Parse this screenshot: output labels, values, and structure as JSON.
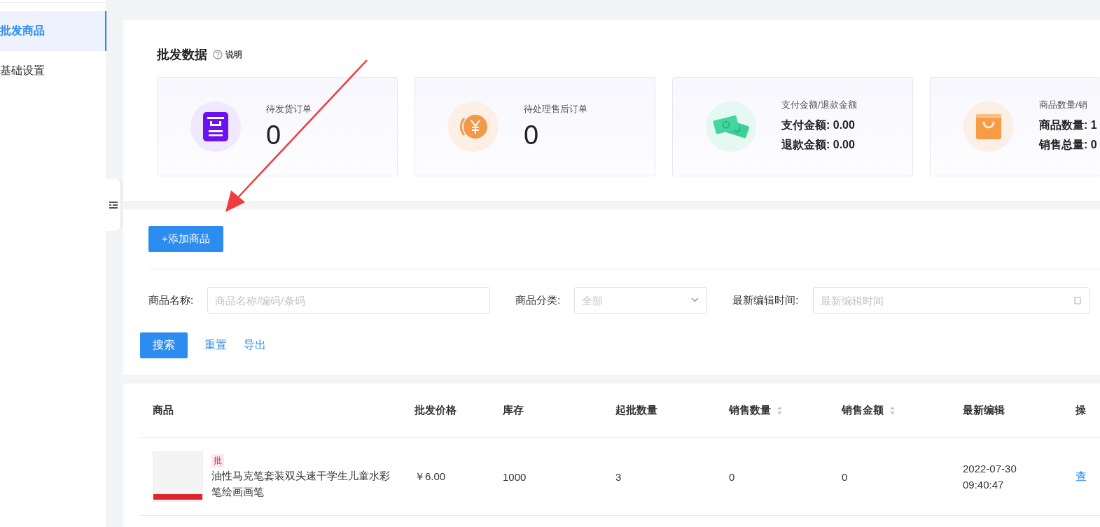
{
  "sidebar": {
    "items": [
      {
        "label": "批发商品",
        "selected": true
      },
      {
        "label": "基础设置",
        "selected": false
      }
    ]
  },
  "stats": {
    "title": "批发数据",
    "help": "说明",
    "cards": [
      {
        "kind": "single",
        "title": "待发货订单",
        "value": "0"
      },
      {
        "kind": "single",
        "title": "待处理售后订单",
        "value": "0"
      },
      {
        "kind": "double",
        "title": "支付金额/退款金额",
        "lines": [
          {
            "label": "支付金额:",
            "value": "0.00"
          },
          {
            "label": "退款金额:",
            "value": "0.00"
          }
        ]
      },
      {
        "kind": "double",
        "title": "商品数量/销",
        "lines": [
          {
            "label": "商品数量:",
            "value": "1"
          },
          {
            "label": "销售总量:",
            "value": "0"
          }
        ]
      }
    ]
  },
  "add_button": "+添加商品",
  "filters": [
    {
      "kind": "text",
      "label": "商品名称:",
      "placeholder": "商品名称/编码/条码"
    },
    {
      "kind": "select",
      "label": "商品分类:",
      "placeholder": "全部"
    },
    {
      "kind": "date",
      "label": "最新编辑时间:",
      "placeholder": "最新编辑时间"
    }
  ],
  "actions": {
    "search": "搜索",
    "links": [
      "重置",
      "导出"
    ]
  },
  "table": {
    "columns": [
      {
        "label": "商品",
        "sortable": false
      },
      {
        "label": "批发价格",
        "sortable": false
      },
      {
        "label": "库存",
        "sortable": false
      },
      {
        "label": "起批数量",
        "sortable": false
      },
      {
        "label": "销售数量",
        "sortable": true
      },
      {
        "label": "销售金额",
        "sortable": true
      },
      {
        "label": "最新编辑",
        "sortable": false
      },
      {
        "label": "操",
        "sortable": false
      }
    ],
    "rows": [
      {
        "tag": "批",
        "name": "油性马克笔套装双头速干学生儿童水彩笔绘画画笔",
        "price": "￥6.00",
        "stock": "1000",
        "min_qty": "3",
        "sold_qty": "0",
        "sold_amount": "0",
        "edited": [
          "2022-07-30",
          "09:40:47"
        ],
        "action": "查"
      }
    ]
  }
}
